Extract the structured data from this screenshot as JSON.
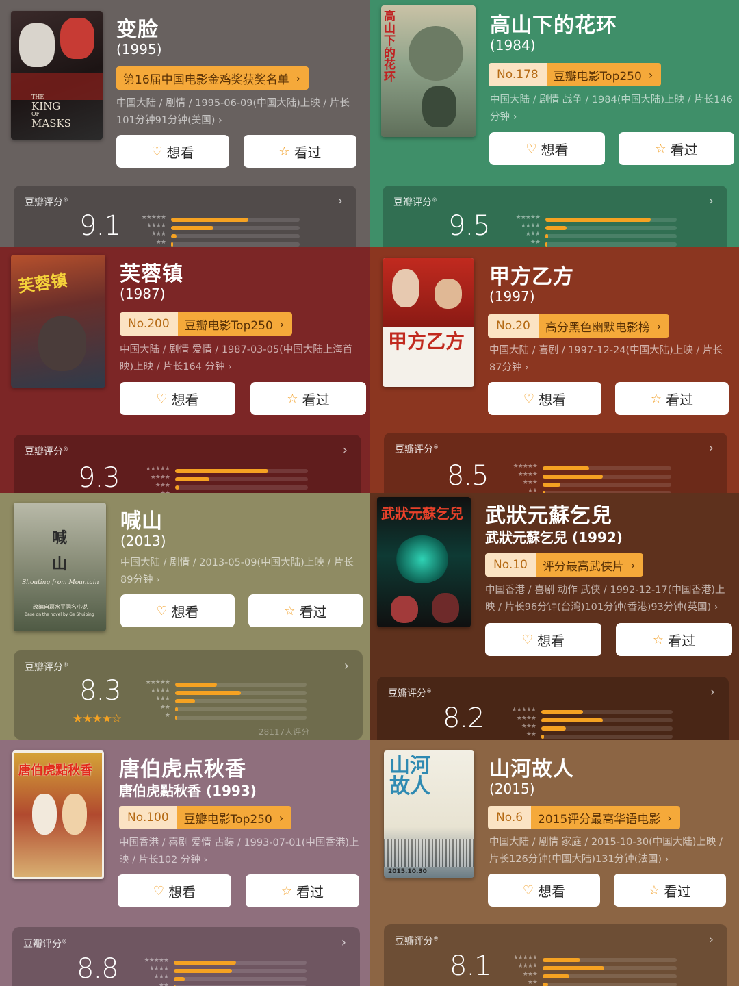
{
  "labels": {
    "want": "想看",
    "seen": "看过",
    "rating": "豆瓣评分"
  },
  "movies": [
    {
      "id": "bianlian",
      "title": "变脸",
      "sub": "(1995)",
      "rank": "",
      "list": "第16届中国电影金鸡奖获奖名单",
      "info": [
        "中国大陆 / 剧情 / 1995-06-09(中国大陆)上映 / 片长",
        "101分钟91分钟(美国) ›"
      ],
      "score": "9.1",
      "dist": [
        0.6,
        0.33,
        0.04,
        0.01,
        0.005
      ],
      "poster_text": [
        "THE",
        "KING",
        "OF",
        "MASKS"
      ]
    },
    {
      "id": "gaoshan",
      "title": "高山下的花环",
      "sub": "(1984)",
      "rank": "No.178",
      "list": "豆瓣电影Top250",
      "info": [
        "中国大陆 / 剧情 战争 / 1984(中国大陆)上映 / 片长146",
        "分钟 ›"
      ],
      "score": "9.5",
      "dist": [
        0.8,
        0.16,
        0.02,
        0.005,
        0.003
      ],
      "poster_text": [
        "高山下的花环"
      ]
    },
    {
      "id": "furong",
      "title": "芙蓉镇",
      "sub": "(1987)",
      "rank": "No.200",
      "list": "豆瓣电影Top250",
      "info": [
        "中国大陆 / 剧情 爱情 / 1987-03-05(中国大陆上海首",
        "映)上映 / 片长164 分钟 ›"
      ],
      "score": "9.3",
      "dist": [
        0.7,
        0.26,
        0.03,
        0.005,
        0.003
      ],
      "poster_text": [
        "芙蓉镇"
      ]
    },
    {
      "id": "jiafang",
      "title": "甲方乙方",
      "sub": "(1997)",
      "rank": "No.20",
      "list": "高分黑色幽默电影榜",
      "info": [
        "中国大陆 / 喜剧 / 1997-12-24(中国大陆)上映 / 片长",
        "87分钟 ›"
      ],
      "score": "8.5",
      "dist": [
        0.36,
        0.47,
        0.14,
        0.02,
        0.01
      ],
      "poster_text": [
        "甲方乙方"
      ]
    },
    {
      "id": "hanshan",
      "title": "喊山",
      "sub": "(2013)",
      "rank": "",
      "list": "",
      "info": [
        "中国大陆 / 剧情 / 2013-05-09(中国大陆)上映 / 片长",
        "89分钟 ›"
      ],
      "score": "8.3",
      "dist": [
        0.32,
        0.5,
        0.15,
        0.02,
        0.01
      ],
      "stars": "★★★★☆",
      "votes": "28117人评分",
      "poster_text": [
        "喊",
        "山",
        "Shouting from Mountain",
        "改编自葛水平同名小说",
        "Base on the novel by Ge Shuiping"
      ]
    },
    {
      "id": "wuzhuangyuan",
      "title": "武狀元蘇乞兒",
      "sub": "武狀元蘇乞兒 (1992)",
      "rank": "No.10",
      "list": "评分最高武侠片",
      "info": [
        "中国香港 / 喜剧 动作 武侠 / 1992-12-17(中国香港)上",
        "映 / 片长96分钟(台湾)101分钟(香港)93分钟(英国) ›"
      ],
      "score": "8.2",
      "dist": [
        0.32,
        0.47,
        0.19,
        0.02,
        0.01
      ],
      "poster_text": [
        "武狀元蘇乞兒"
      ]
    },
    {
      "id": "tangbohu",
      "title": "唐伯虎点秋香",
      "sub": "唐伯虎點秋香 (1993)",
      "rank": "No.100",
      "list": "豆瓣电影Top250",
      "info": [
        "中国香港 / 喜剧 爱情 古装 / 1993-07-01(中国香港)上",
        "映 / 片长102 分钟 ›"
      ],
      "score": "8.8",
      "dist": [
        0.47,
        0.44,
        0.08,
        0.01,
        0.005
      ],
      "poster_text": [
        "唐伯虎點秋香"
      ]
    },
    {
      "id": "shanhe",
      "title": "山河故人",
      "sub": "(2015)",
      "rank": "No.6",
      "list": "2015评分最高华语电影",
      "info": [
        "中国大陆 / 剧情 家庭 / 2015-10-30(中国大陆)上映 /",
        "片长126分钟(中国大陆)131分钟(法国) ›"
      ],
      "score": "8.1",
      "dist": [
        0.28,
        0.46,
        0.2,
        0.04,
        0.02
      ],
      "poster_text": [
        "山河故人",
        "2015.10.30"
      ]
    }
  ],
  "colors": {
    "bianlian": "#68615f",
    "gaoshan": "#3f8f69",
    "furong": "#7c2626",
    "jiafang": "#8b3620",
    "hanshan": "#8f8b63",
    "wuzhuangyuan": "#5e311d",
    "tangbohu": "#8f6f7d",
    "shanhe": "#8c6544",
    "accent": "#f5a222"
  },
  "icons": {
    "want": "heart-plus-icon",
    "seen": "star-outline-icon",
    "more": "chevron-right-icon"
  }
}
